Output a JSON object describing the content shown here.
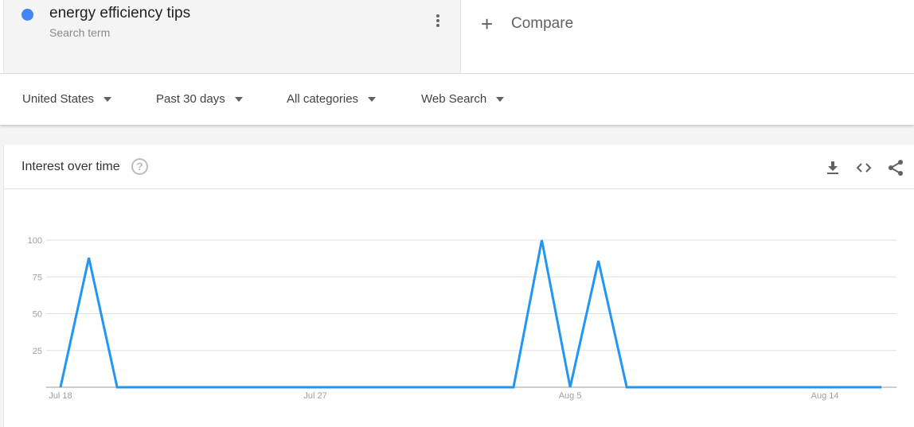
{
  "search_term": {
    "name": "energy efficiency tips",
    "subtitle": "Search term",
    "color": "#4285f4",
    "menu_icon": "more-vert-icon"
  },
  "compare": {
    "icon": "plus-icon",
    "label": "Compare"
  },
  "filters": [
    {
      "label": "United States",
      "icon": "caret-down-icon"
    },
    {
      "label": "Past 30 days",
      "icon": "caret-down-icon"
    },
    {
      "label": "All categories",
      "icon": "caret-down-icon"
    },
    {
      "label": "Web Search",
      "icon": "caret-down-icon"
    }
  ],
  "card": {
    "title": "Interest over time",
    "help_icon": "help-circle-icon",
    "help_glyph": "?",
    "actions": [
      {
        "name": "download-icon"
      },
      {
        "name": "embed-code-icon"
      },
      {
        "name": "share-icon"
      }
    ]
  },
  "chart_data": {
    "type": "line",
    "title": "Interest over time",
    "xlabel": "",
    "ylabel": "",
    "ylim": [
      0,
      100
    ],
    "yticks": [
      25,
      50,
      75,
      100
    ],
    "ytick_labels": [
      "25",
      "50",
      "75",
      "100"
    ],
    "xtick_labels": [
      "Jul 18",
      "Jul 27",
      "Aug 5",
      "Aug 14"
    ],
    "xtick_indices": [
      0,
      9,
      18,
      27
    ],
    "grid": true,
    "legend": "none",
    "series": [
      {
        "name": "energy efficiency tips",
        "color": "#2196f3",
        "x": [
          "Jul 18",
          "Jul 19",
          "Jul 20",
          "Jul 21",
          "Jul 22",
          "Jul 23",
          "Jul 24",
          "Jul 25",
          "Jul 26",
          "Jul 27",
          "Jul 28",
          "Jul 29",
          "Jul 30",
          "Jul 31",
          "Aug 1",
          "Aug 2",
          "Aug 3",
          "Aug 4",
          "Aug 5",
          "Aug 6",
          "Aug 7",
          "Aug 8",
          "Aug 9",
          "Aug 10",
          "Aug 11",
          "Aug 12",
          "Aug 13",
          "Aug 14",
          "Aug 15",
          "Aug 16"
        ],
        "values": [
          0,
          88,
          0,
          0,
          0,
          0,
          0,
          0,
          0,
          0,
          0,
          0,
          0,
          0,
          0,
          0,
          0,
          100,
          0,
          86,
          0,
          0,
          0,
          0,
          0,
          0,
          0,
          0,
          0,
          0
        ]
      }
    ]
  }
}
